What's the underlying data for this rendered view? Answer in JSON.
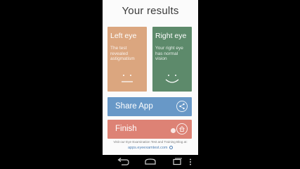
{
  "app": {
    "title": "Your results"
  },
  "cards": {
    "left": {
      "title": "Left eye",
      "description": "The test revealed astigmatism",
      "face": "neutral-face-icon",
      "color": "#dba67f"
    },
    "right": {
      "title": "Right eye",
      "description": "Your right eye has normal vision",
      "face": "smile-face-icon",
      "color": "#5d8a6b"
    }
  },
  "buttons": {
    "share_label": "Share App",
    "share_icon": "share-icon",
    "share_color": "#6898c7",
    "finish_label": "Finish",
    "finish_icon": "home-icon",
    "finish_color": "#dd8275"
  },
  "footer": {
    "text": "Visit our Eye Examination Test and Training Blog at:",
    "link": "apps.eyeexamtest.com"
  },
  "navbar": {
    "icons": [
      "back-icon",
      "home-icon",
      "recents-icon",
      "menu-icon"
    ]
  }
}
